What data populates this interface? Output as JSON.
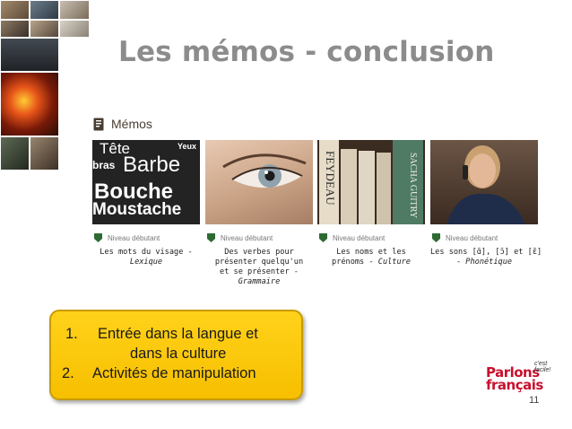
{
  "slide": {
    "title": "Les mémos - conclusion",
    "page_number": "11"
  },
  "memos": {
    "label": "Mémos",
    "cards": [
      {
        "level": "Niveau débutant",
        "title_lines": [
          "Les mots du visage -"
        ],
        "category": "Lexique",
        "image_words": [
          "Tête",
          "Yeux",
          "bras",
          "Barbe",
          "Bouche",
          "Moustache"
        ]
      },
      {
        "level": "Niveau débutant",
        "title_lines": [
          "Des verbes pour",
          "présenter quelqu'un",
          "et se présenter -"
        ],
        "category": "Grammaire"
      },
      {
        "level": "Niveau débutant",
        "title_lines": [
          "Les noms et les",
          "prénoms - "
        ],
        "category": "Culture",
        "image_words": [
          "FEYDEAU",
          "SACHA GUITRY"
        ]
      },
      {
        "level": "Niveau débutant",
        "title_lines": [
          "Les sons [ɑ̃], [ɔ̃] et [ɛ̃]",
          "- "
        ],
        "category": "Phonétique"
      }
    ]
  },
  "callout": {
    "items": [
      {
        "number": "1.",
        "line1": "Entrée dans la langue et",
        "line2": "dans la culture"
      },
      {
        "number": "2.",
        "line1": "Activités de manipulation"
      }
    ]
  },
  "logo": {
    "line1": "Parlons",
    "line2": "français",
    "tag": "c'est facile!"
  },
  "colors": {
    "title": "#8c8c8c",
    "callout_bg": "#f7bf00",
    "logo_red": "#c8102e",
    "level_icon": "#2e6b33"
  }
}
